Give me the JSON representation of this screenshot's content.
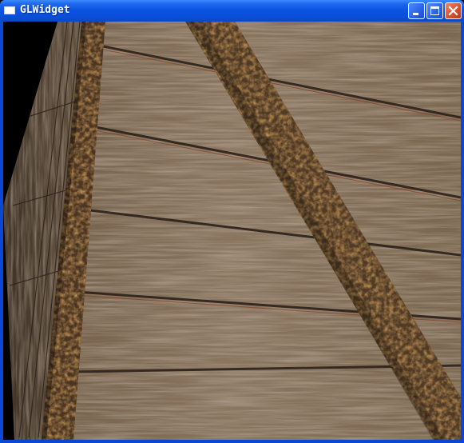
{
  "window": {
    "title": "GLWidget",
    "icons": {
      "app": "window-icon",
      "minimize": "minimize-icon",
      "maximize": "maximize-icon",
      "close": "close-icon"
    }
  },
  "scene": {
    "description_icon": "textured-crate-3d-view"
  },
  "colors": {
    "titlebar": "#0a55e3",
    "frame": "#0a47d6",
    "close_button": "#d4552c",
    "background": "#000000",
    "wood": "#7d6a55",
    "iron": "#5a3e22"
  }
}
